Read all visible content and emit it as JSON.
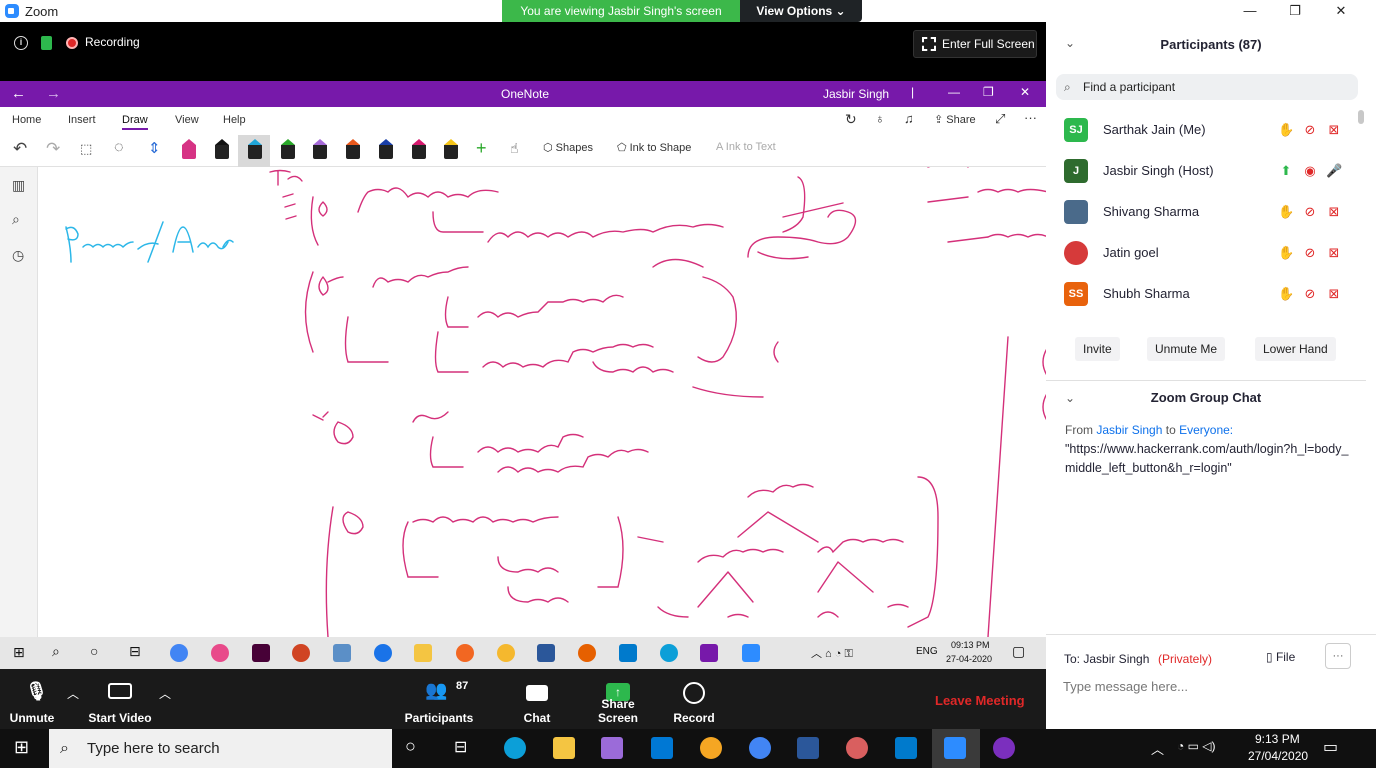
{
  "window": {
    "title": "Zoom",
    "minimize": "—",
    "maximize": "❐",
    "close": "✕"
  },
  "banner": {
    "viewing": "You are viewing Jasbir Singh's screen",
    "view_options": "View Options ⌄"
  },
  "meeting": {
    "recording": "Recording",
    "fullscreen": "Enter Full Screen"
  },
  "onenote": {
    "title": "OneNote",
    "user": "Jasbir Singh",
    "menu": [
      "Home",
      "Insert",
      "Draw",
      "View",
      "Help"
    ],
    "share": "Share",
    "shapes": "Shapes",
    "ink_to_shape": "Ink to Shape",
    "ink_to_text": "Ink to Text",
    "pen_colors": [
      "#d63384",
      "#111111",
      "#20a6d9",
      "#2aa82a",
      "#a66bd9",
      "#e8581c",
      "#1a3fa8",
      "#d61a6e",
      "#f5c518"
    ]
  },
  "share_taskbar": {
    "lang": "ENG",
    "time": "09:13 PM",
    "date": "27-04-2020"
  },
  "controls": {
    "unmute": "Unmute",
    "start_video": "Start Video",
    "participants": "Participants",
    "participants_count": "87",
    "chat": "Chat",
    "share_screen": "Share Screen",
    "record": "Record",
    "leave": "Leave Meeting"
  },
  "panel": {
    "participants_title": "Participants (87)",
    "search_placeholder": "Find a participant",
    "participants": [
      {
        "initials": "SJ",
        "name": "Sarthak Jain (Me)",
        "color": "#2db84d"
      },
      {
        "initials": "J",
        "name": "Jasbir Singh (Host)",
        "color": "#2e6b2e"
      },
      {
        "initials": "",
        "name": "Shivang Sharma",
        "color": "#4a6a8a"
      },
      {
        "initials": "",
        "name": "Jatin goel",
        "color": "#d63a3a"
      },
      {
        "initials": "SS",
        "name": "Shubh Sharma",
        "color": "#e8620c"
      }
    ],
    "invite": "Invite",
    "unmute_me": "Unmute Me",
    "lower_hand": "Lower Hand",
    "chat_title": "Zoom Group Chat",
    "chat_from": "From",
    "chat_sender": "Jasbir Singh",
    "chat_to": "to",
    "chat_recipient": "Everyone:",
    "chat_text": "\"https://www.hackerrank.com/auth/login?h_l=body_middle_left_button&h_r=login\"",
    "to_label": "To: Jasbir Singh",
    "privately": "(Privately)",
    "file": "File",
    "more": "···",
    "message_placeholder": "Type message here..."
  },
  "win_taskbar": {
    "search": "Type here to search",
    "time": "9:13 PM",
    "date": "27/04/2020"
  }
}
